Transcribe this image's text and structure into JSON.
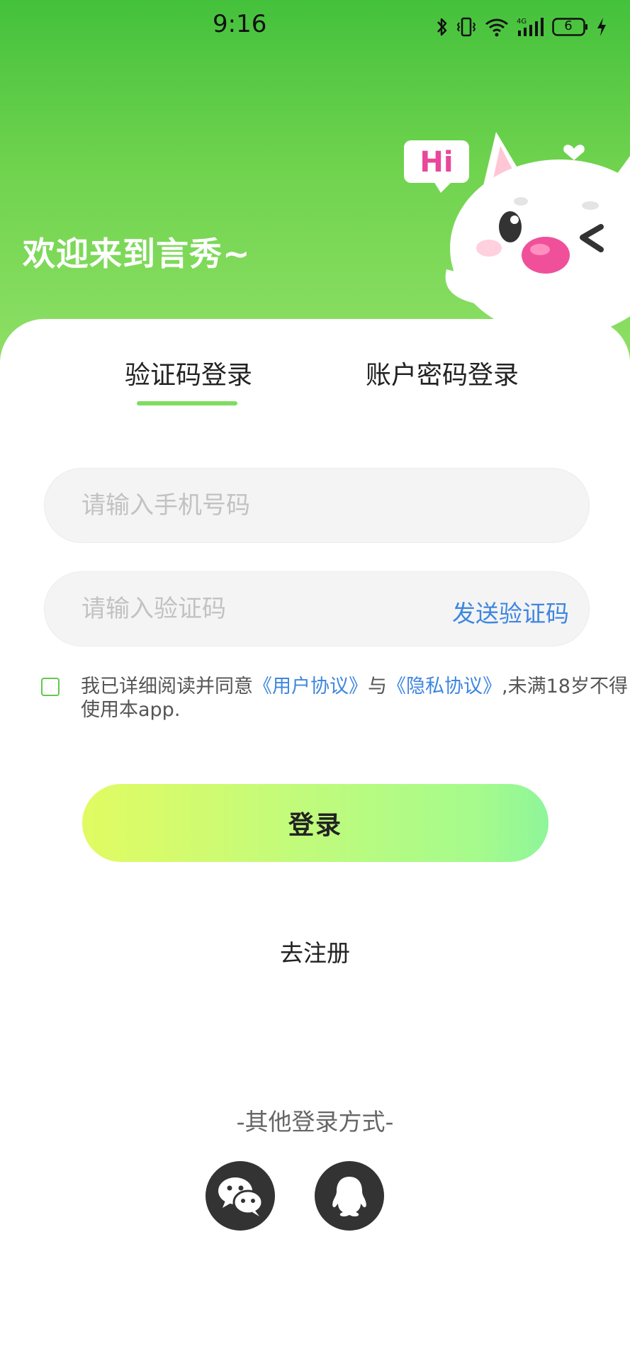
{
  "status_bar": {
    "time": "9:16",
    "battery_level": "6",
    "network_label": "4G",
    "icons": [
      "bluetooth-icon",
      "vibrate-icon",
      "wifi-icon",
      "signal-icon",
      "battery-icon",
      "charging-icon"
    ]
  },
  "header": {
    "welcome": "欢迎来到言秀~",
    "mascot_bubble": "Hi"
  },
  "tabs": [
    {
      "label": "验证码登录",
      "active": true
    },
    {
      "label": "账户密码登录",
      "active": false
    }
  ],
  "form": {
    "phone_placeholder": "请输入手机号码",
    "phone_value": "",
    "code_placeholder": "请输入验证码",
    "code_value": "",
    "send_code_label": "发送验证码"
  },
  "agreement": {
    "checked": false,
    "prefix": "我已详细阅读并同意",
    "user_agreement": "《用户协议》",
    "middle": "与",
    "privacy_policy": "《隐私协议》",
    "suffix": ",未满18岁不得使用本app."
  },
  "login_button": "登录",
  "register_link": "去注册",
  "other_login": {
    "title": "-其他登录方式-",
    "methods": [
      {
        "name": "wechat",
        "icon": "wechat-icon"
      },
      {
        "name": "qq",
        "icon": "qq-icon"
      }
    ]
  },
  "colors": {
    "header_green": "#44c13c",
    "tab_indicator": "#7fdc63",
    "link_blue": "#3f86e0",
    "checkbox_green": "#63c84d",
    "button_gradient_start": "#e1fb62",
    "button_gradient_end": "#8ef59a",
    "social_bg": "#333333"
  }
}
